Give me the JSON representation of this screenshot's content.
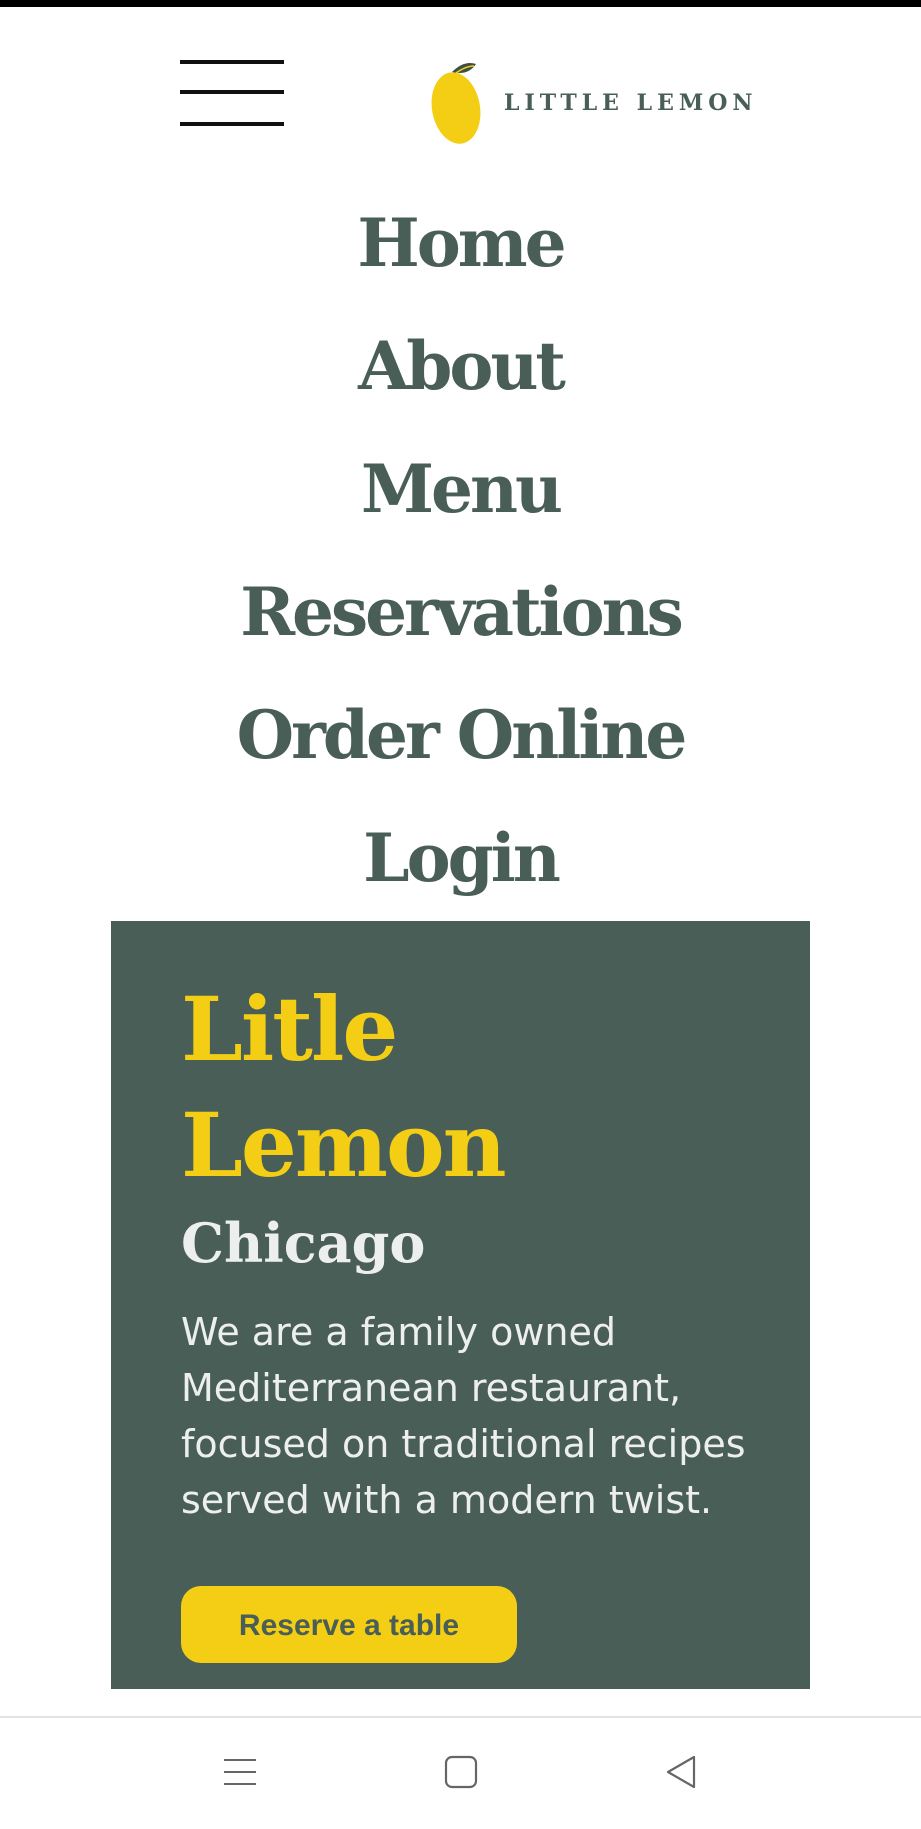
{
  "header": {
    "menu_icon": "hamburger-menu-icon",
    "logo_text": "LITTLE LEMON",
    "logo_icon": "lemon-icon"
  },
  "nav": {
    "items": [
      "Home",
      "About",
      "Menu",
      "Reservations",
      "Order Online",
      "Login"
    ]
  },
  "hero": {
    "title_line1": "Litle",
    "title_line2": "Lemon",
    "city": "Chicago",
    "description": "We are a family owned Mediterranean restaurant, focused on traditional recipes served with a modern twist.",
    "button_label": "Reserve a table"
  },
  "system_nav": {
    "recents_icon": "recents-icon",
    "home_icon": "home-square-icon",
    "back_icon": "back-triangle-icon"
  },
  "colors": {
    "primary_green": "#495e57",
    "primary_yellow": "#f4ce14",
    "light_text": "#edefee"
  }
}
